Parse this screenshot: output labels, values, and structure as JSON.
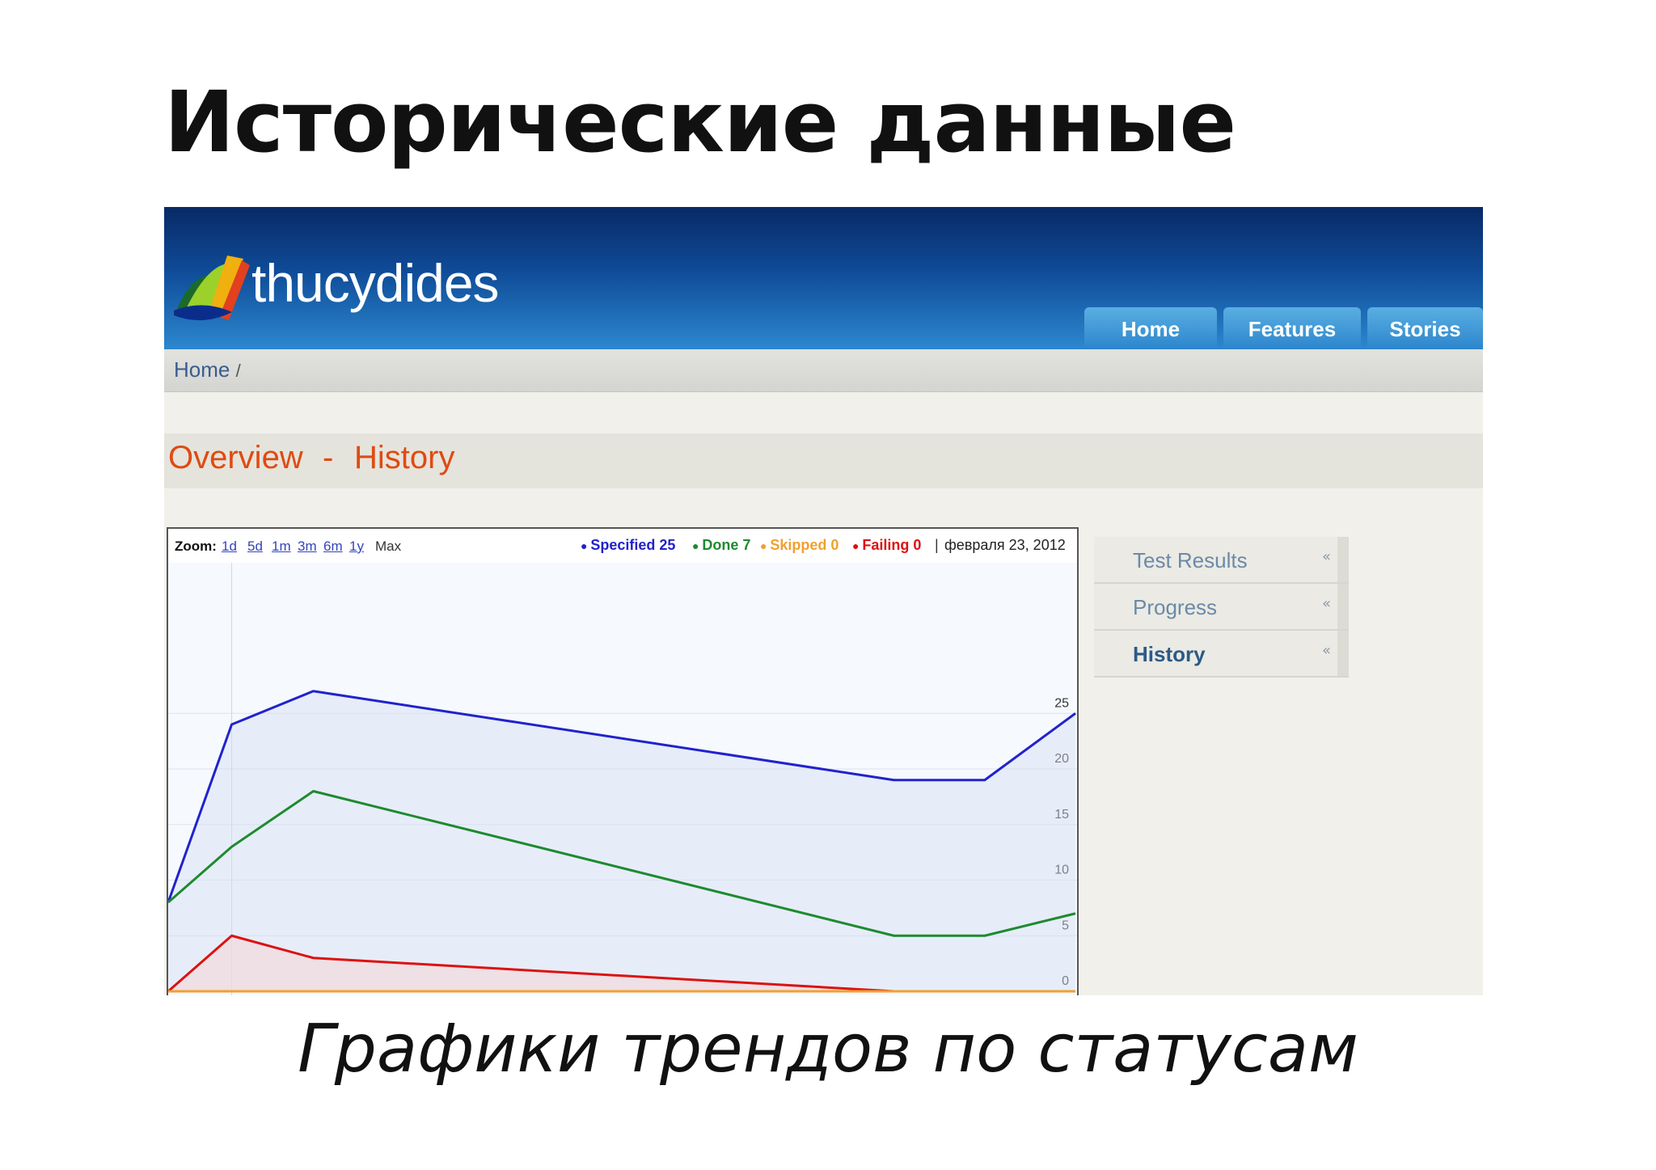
{
  "slide_title": "Исторические данные",
  "caption": "Графики трендов по статусам",
  "app": {
    "brand": "thucydides",
    "nav": [
      "Home",
      "Features",
      "Stories"
    ],
    "breadcrumb": {
      "home": "Home",
      "sep": "/"
    },
    "page_title": {
      "part1": "Overview",
      "dash": "-",
      "part2": "History"
    }
  },
  "chart_toolbar": {
    "zoom_label": "Zoom:",
    "zoom_options": [
      "1d",
      "5d",
      "1m",
      "3m",
      "6m",
      "1y"
    ],
    "zoom_max": "Max",
    "legend": [
      {
        "label": "Specified 25",
        "color": "#2222cc"
      },
      {
        "label": "Done 7",
        "color": "#1e8a2e"
      },
      {
        "label": "Skipped 0",
        "color": "#f0a030"
      },
      {
        "label": "Failing 0",
        "color": "#dd1111"
      }
    ],
    "date_sep": "|",
    "date": "февраля 23, 2012"
  },
  "side_menu": [
    {
      "label": "Test Results",
      "active": false
    },
    {
      "label": "Progress",
      "active": false
    },
    {
      "label": "History",
      "active": true
    }
  ],
  "chart_data": {
    "type": "line",
    "x": [
      0,
      1,
      2,
      3,
      4,
      5,
      6,
      7,
      8,
      9,
      10,
      11,
      12,
      13,
      14,
      15
    ],
    "ylim": [
      0,
      30
    ],
    "yticks": [
      0,
      5,
      10,
      15,
      20,
      25
    ],
    "grid": true,
    "legend": "top-right",
    "series": [
      {
        "name": "Specified",
        "color": "#2222cc",
        "points": [
          [
            0,
            8
          ],
          [
            0.7,
            24
          ],
          [
            1.6,
            27
          ],
          [
            8,
            19
          ],
          [
            9,
            19
          ],
          [
            10,
            25
          ]
        ]
      },
      {
        "name": "Done",
        "color": "#1e8a2e",
        "points": [
          [
            0,
            8
          ],
          [
            0.7,
            13
          ],
          [
            1.6,
            18
          ],
          [
            8,
            5
          ],
          [
            9,
            5
          ],
          [
            10,
            7
          ]
        ]
      },
      {
        "name": "Failing",
        "color": "#dd1111",
        "points": [
          [
            0,
            0
          ],
          [
            0.7,
            5
          ],
          [
            1.6,
            3
          ],
          [
            8,
            0
          ],
          [
            10,
            0
          ]
        ]
      },
      {
        "name": "Skipped",
        "color": "#f0a030",
        "points": [
          [
            0,
            0
          ],
          [
            10,
            0
          ]
        ]
      }
    ]
  }
}
